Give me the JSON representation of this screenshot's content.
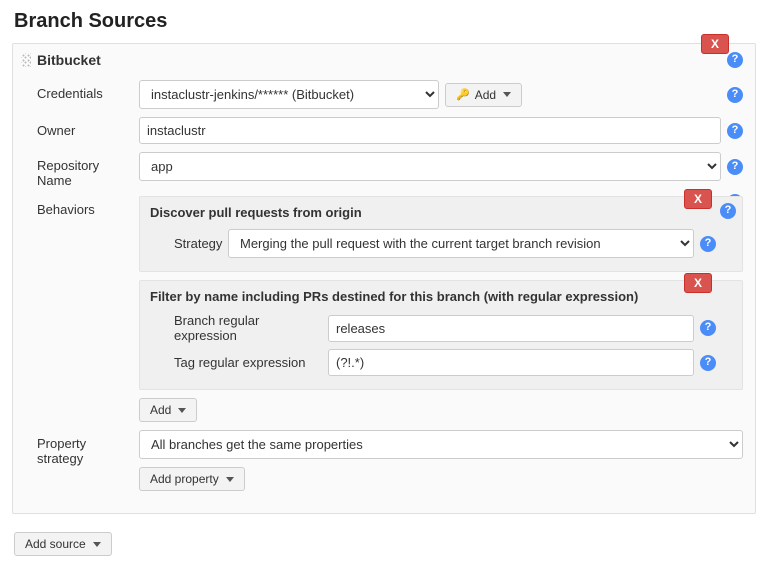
{
  "section_title": "Branch Sources",
  "delete_label": "X",
  "source": {
    "title": "Bitbucket",
    "credentials": {
      "label": "Credentials",
      "selected": "instaclustr-jenkins/****** (Bitbucket)",
      "add_button": "Add"
    },
    "owner": {
      "label": "Owner",
      "value": "instaclustr"
    },
    "repository": {
      "label": "Repository Name",
      "selected": "app"
    },
    "behaviors": {
      "label": "Behaviors",
      "add_button": "Add",
      "items": [
        {
          "title": "Discover pull requests from origin",
          "strategy_label": "Strategy",
          "strategy_value": "Merging the pull request with the current target branch revision"
        },
        {
          "title": "Filter by name including PRs destined for this branch (with regular expression)",
          "branch_regex_label": "Branch regular expression",
          "branch_regex_value": "releases",
          "tag_regex_label": "Tag regular expression",
          "tag_regex_value": "(?!.*)"
        }
      ]
    },
    "property_strategy": {
      "label": "Property strategy",
      "selected": "All branches get the same properties",
      "add_property_button": "Add property"
    }
  },
  "add_source_button": "Add source"
}
